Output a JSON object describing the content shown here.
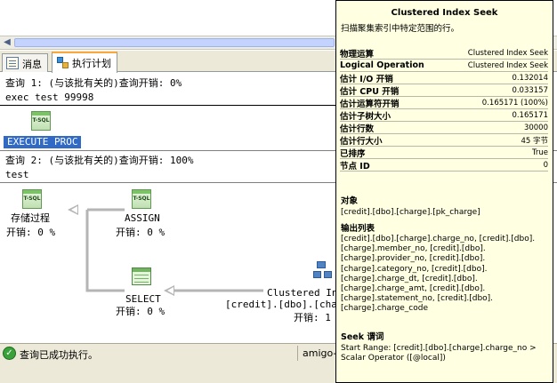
{
  "tabs": [
    {
      "label": "消息",
      "icon": "messages-icon"
    },
    {
      "label": "执行计划",
      "icon": "execution-plan-icon"
    }
  ],
  "query1": {
    "header": "查询 1: (与该批有关的)查询开销: 0%",
    "statement": "exec test 99998",
    "node_icon_label": "T-SQL",
    "node_caption": "EXECUTE PROC"
  },
  "query2": {
    "header": "查询 2: (与该批有关的)查询开销: 100%",
    "statement": "test",
    "nodes": {
      "proc": {
        "icon_label": "T-SQL",
        "title": "存储过程",
        "cost": "开销: 0 %"
      },
      "assign": {
        "icon_label": "T-SQL",
        "title": "ASSIGN",
        "cost": "开销: 0 %"
      },
      "select": {
        "title": "SELECT",
        "cost": "开销: 0 %"
      },
      "seek": {
        "title": "Clustered In",
        "object": "[credit].[dbo].[cha",
        "cost": "开销: 1"
      }
    }
  },
  "status": {
    "message": "查询已成功执行。",
    "server": "amigo-v"
  },
  "tooltip": {
    "title": "Clustered Index Seek",
    "description": "扫描聚集索引中特定范围的行。",
    "rows": [
      {
        "key": "物理运算",
        "value": "Clustered Index Seek"
      },
      {
        "key": "Logical Operation",
        "value": "Clustered Index Seek"
      },
      {
        "key": "估计 I/O 开销",
        "value": "0.132014"
      },
      {
        "key": "估计 CPU 开销",
        "value": "0.033157"
      },
      {
        "key": "估计运算符开销",
        "value": "0.165171 (100%)"
      },
      {
        "key": "估计子树大小",
        "value": "0.165171"
      },
      {
        "key": "估计行数",
        "value": "30000"
      },
      {
        "key": "估计行大小",
        "value": "45 字节"
      },
      {
        "key": "已排序",
        "value": "True"
      },
      {
        "key": "节点 ID",
        "value": "0"
      }
    ],
    "object_header": "对象",
    "object_value": "[credit].[dbo].[charge].[pk_charge]",
    "output_header": "输出列表",
    "output_value": "[credit].[dbo].[charge].charge_no, [credit].[dbo].[charge].member_no, [credit].[dbo].[charge].provider_no, [credit].[dbo].[charge].category_no, [credit].[dbo].[charge].charge_dt, [credit].[dbo].[charge].charge_amt, [credit].[dbo].[charge].statement_no, [credit].[dbo].[charge].charge_code",
    "seek_header": "Seek 谓词",
    "seek_value": "Start Range: [credit].[dbo].[charge].charge_no > Scalar Operator ([@local])"
  }
}
